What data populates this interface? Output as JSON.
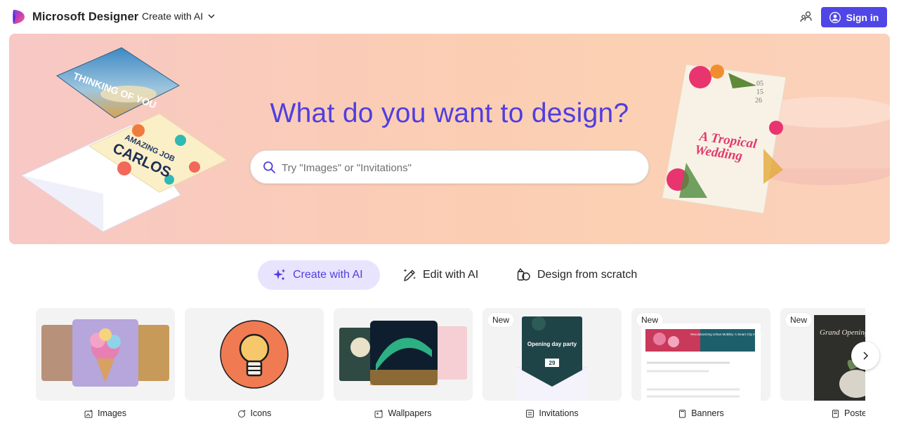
{
  "app": {
    "name": "Microsoft Designer",
    "create_menu_label": "Create with AI",
    "signin_label": "Sign in"
  },
  "hero": {
    "title": "What do you want to design?",
    "search_placeholder": "Try \"Images\" or \"Invitations\"",
    "search_value": "",
    "art_texts": {
      "thinking_card": "THINKING OF YOU",
      "amazing_job": "AMAZING JOB",
      "carlos": "CARLOS",
      "wedding_title": "A Tropical Wedding",
      "wedding_date": [
        "05",
        "15",
        "26"
      ]
    }
  },
  "tabs": [
    {
      "label": "Create with AI",
      "icon": "sparkle-icon",
      "active": true
    },
    {
      "label": "Edit with AI",
      "icon": "magic-pen-icon",
      "active": false
    },
    {
      "label": "Design from scratch",
      "icon": "shapes-icon",
      "active": false
    }
  ],
  "categories": [
    {
      "label": "Images",
      "icon": "image-sparkle-icon",
      "is_new": false
    },
    {
      "label": "Icons",
      "icon": "icon-sparkle-icon",
      "is_new": false
    },
    {
      "label": "Wallpapers",
      "icon": "wallpaper-sparkle-icon",
      "is_new": false
    },
    {
      "label": "Invitations",
      "icon": "invitation-icon",
      "is_new": true,
      "thumb_text": "Opening day party",
      "thumb_date": "29"
    },
    {
      "label": "Banners",
      "icon": "banner-icon",
      "is_new": true,
      "thumb_text": "Revolutionizing Urban Mobility: A Smart City Initiative"
    },
    {
      "label": "Posters",
      "icon": "poster-icon",
      "is_new": true,
      "thumb_text": "Grand Opening"
    }
  ],
  "new_badge": "New",
  "colors": {
    "accent": "#4f46e5",
    "title": "#4f3ee0",
    "active_tab_bg": "#e9e4fd"
  }
}
